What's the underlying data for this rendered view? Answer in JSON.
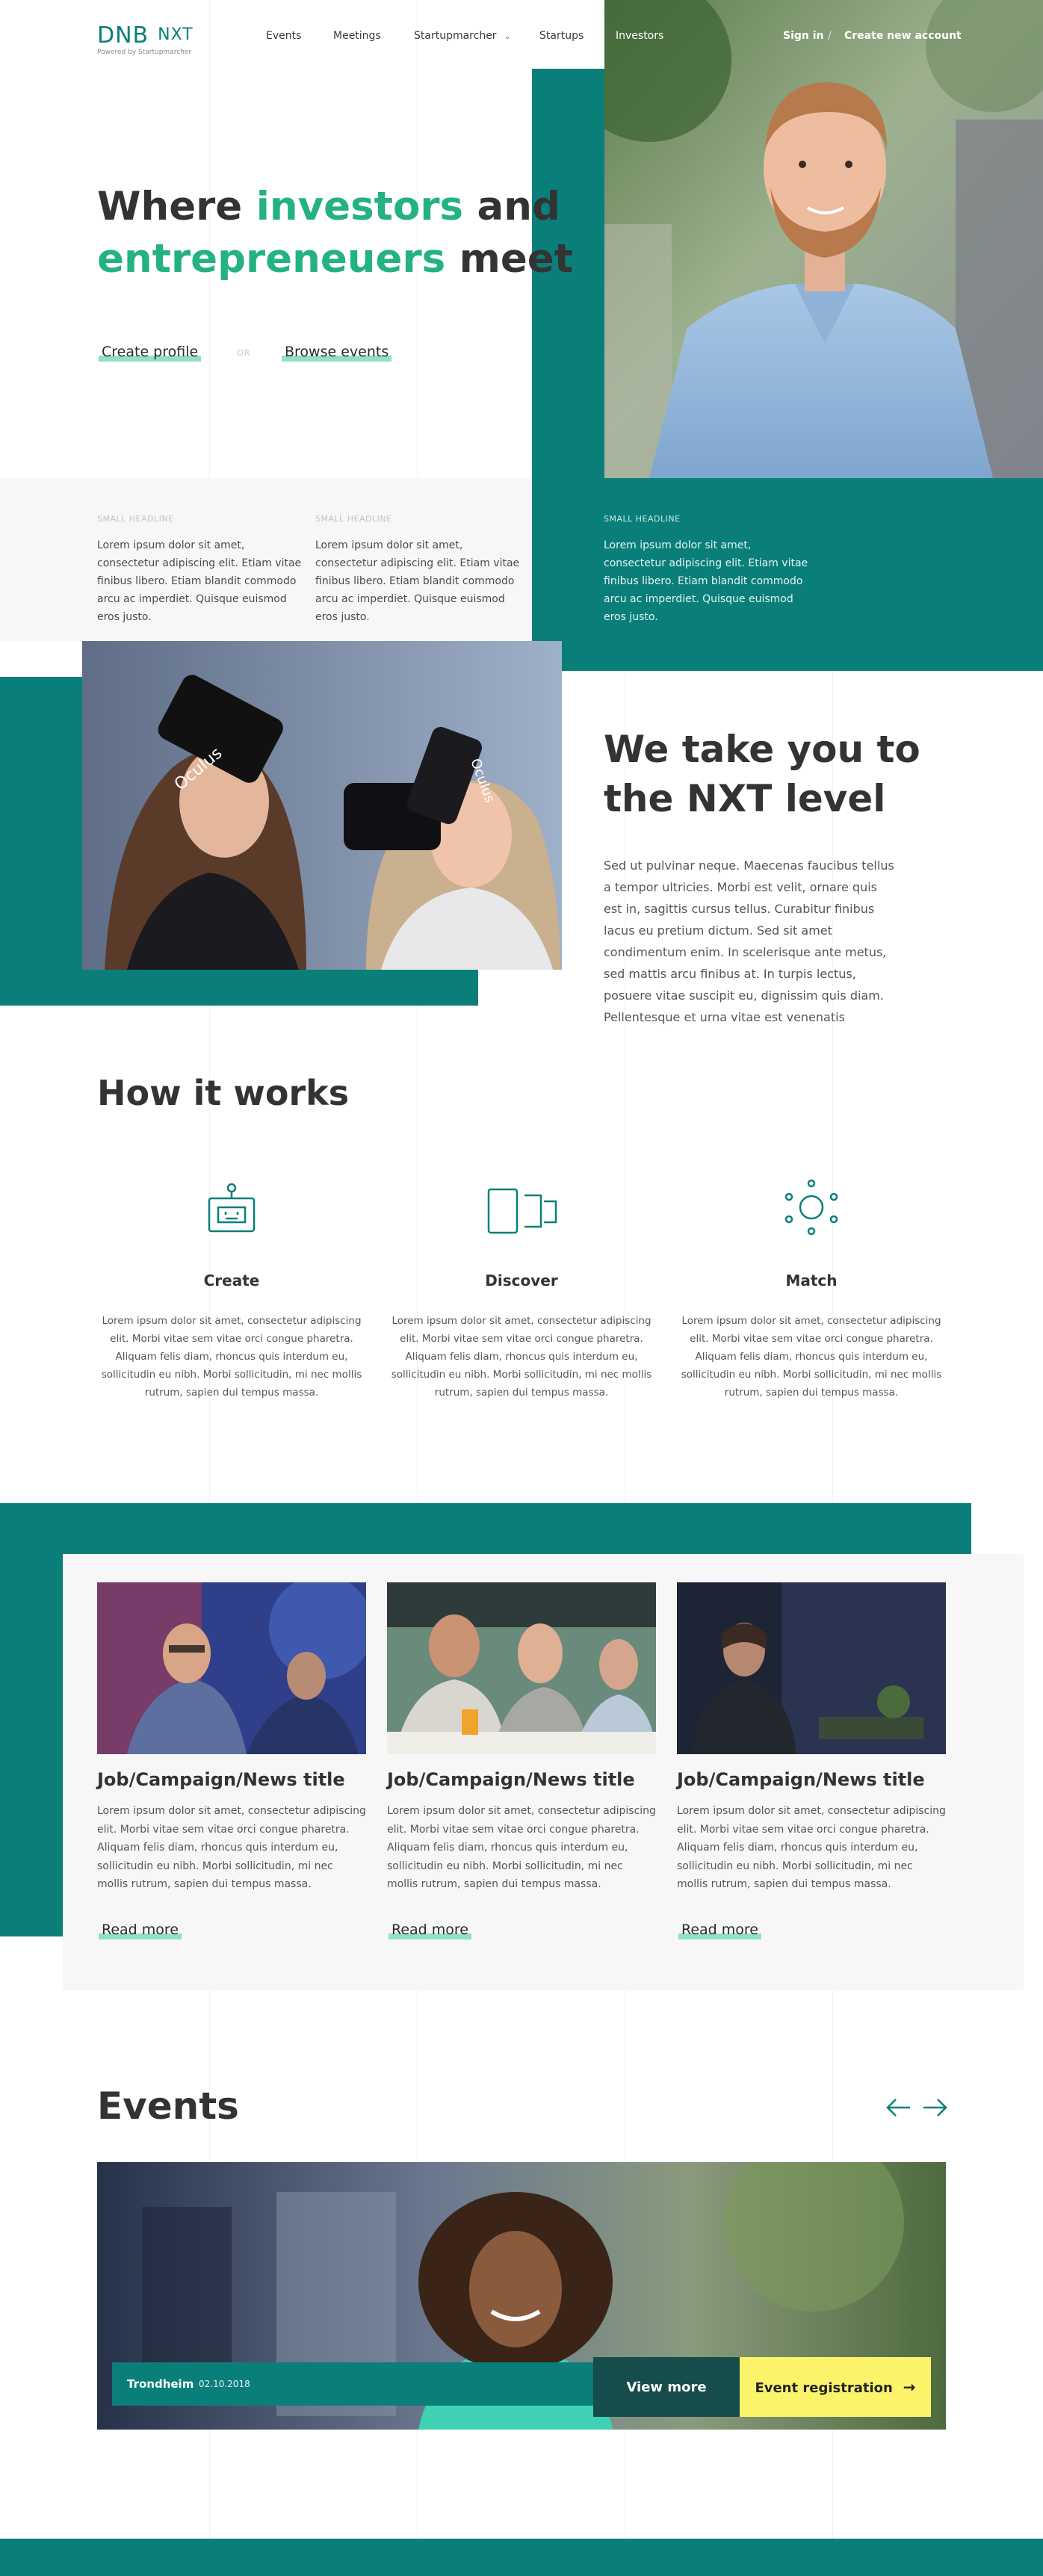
{
  "nav": {
    "logo": "DNB",
    "logo_suffix": "NXT",
    "powered_by": "Powered by Startupmarcher",
    "items": [
      "Events",
      "Meetings",
      "Startupmarcher",
      "Startups",
      "Investors"
    ],
    "sign_in": "Sign in",
    "separator": "/",
    "create_account": "Create new account"
  },
  "hero": {
    "title_1": "Where ",
    "title_highlight_1": "investors",
    "title_2": " and",
    "title_highlight_2": "entrepreneuers",
    "title_3": " meet",
    "cta_primary": "Create profile",
    "or": "OR",
    "cta_secondary": "Browse events"
  },
  "features": [
    {
      "headline": "SMALL HEADLINE",
      "text": "Lorem ipsum dolor sit amet, consectetur adipiscing elit. Etiam vitae finibus libero. Etiam blandit commodo arcu ac imperdiet. Quisque euismod eros justo."
    },
    {
      "headline": "SMALL HEADLINE",
      "text": "Lorem ipsum dolor sit amet, consectetur adipiscing elit. Etiam vitae finibus libero. Etiam blandit commodo arcu ac imperdiet. Quisque euismod eros justo."
    },
    {
      "headline": "SMALL HEADLINE",
      "text": "Lorem ipsum dolor sit amet, consectetur adipiscing elit. Etiam vitae finibus libero. Etiam blandit commodo arcu ac imperdiet. Quisque euismod eros justo."
    }
  ],
  "nxt": {
    "title_1": "We take you to",
    "title_2": "the NXT level",
    "text": "Sed ut pulvinar neque. Maecenas faucibus tellus a tempor ultricies. Morbi est velit, ornare quis est in, sagittis cursus tellus. Curabitur finibus lacus eu pretium dictum. Sed sit amet condimentum enim. In scelerisque ante metus, sed mattis arcu finibus at. In turpis lectus, posuere vitae suscipit eu, dignissim quis diam. Pellentesque et urna vitae est venenatis"
  },
  "how": {
    "title": "How it works",
    "steps": [
      {
        "name": "Create",
        "icon": "robot-icon",
        "text": "Lorem ipsum dolor sit amet, consectetur adipiscing elit. Morbi vitae sem vitae orci congue pharetra. Aliquam felis diam, rhoncus quis interdum eu, sollicitudin eu nibh. Morbi sollicitudin, mi nec mollis rutrum, sapien dui tempus massa."
      },
      {
        "name": "Discover",
        "icon": "devices-icon",
        "text": "Lorem ipsum dolor sit amet, consectetur adipiscing elit. Morbi vitae sem vitae orci congue pharetra. Aliquam felis diam, rhoncus quis interdum eu, sollicitudin eu nibh. Morbi sollicitudin, mi nec mollis rutrum, sapien dui tempus massa."
      },
      {
        "name": "Match",
        "icon": "network-icon",
        "text": "Lorem ipsum dolor sit amet, consectetur adipiscing elit. Morbi vitae sem vitae orci congue pharetra. Aliquam felis diam, rhoncus quis interdum eu, sollicitudin eu nibh. Morbi sollicitudin, mi nec mollis rutrum, sapien dui tempus massa."
      }
    ]
  },
  "cards": [
    {
      "title": "Job/Campaign/News title",
      "text": "Lorem ipsum dolor sit amet, consectetur adipiscing elit. Morbi vitae sem vitae orci congue pharetra. Aliquam felis diam, rhoncus quis interdum eu, sollicitudin eu nibh. Morbi sollicitudin, mi nec mollis rutrum, sapien dui tempus massa.",
      "link": "Read more"
    },
    {
      "title": "Job/Campaign/News title",
      "text": "Lorem ipsum dolor sit amet, consectetur adipiscing elit. Morbi vitae sem vitae orci congue pharetra. Aliquam felis diam, rhoncus quis interdum eu, sollicitudin eu nibh. Morbi sollicitudin, mi nec mollis rutrum, sapien dui tempus massa.",
      "link": "Read more"
    },
    {
      "title": "Job/Campaign/News title",
      "text": "Lorem ipsum dolor sit amet, consectetur adipiscing elit. Morbi vitae sem vitae orci congue pharetra. Aliquam felis diam, rhoncus quis interdum eu, sollicitudin eu nibh. Morbi sollicitudin, mi nec mollis rutrum, sapien dui tempus massa.",
      "link": "Read more"
    }
  ],
  "events": {
    "title": "Events",
    "prev_icon": "arrow-left-icon",
    "next_icon": "arrow-right-icon",
    "city": "Trondheim",
    "date": "02.10.2018",
    "view_more": "View more",
    "register": "Event registration"
  },
  "colors": {
    "teal": "#0a7f7a",
    "green_accent": "#24b184",
    "underline": "#86dcc2",
    "dark_teal": "#164c4c",
    "yellow": "#fbf46b",
    "light_gray": "#f7f7f7"
  }
}
